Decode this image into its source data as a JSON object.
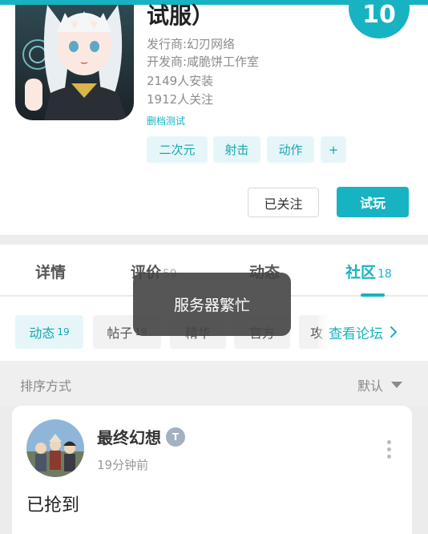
{
  "game": {
    "title": "试服）",
    "score": "10",
    "publisher": "发行商:幻刃网络",
    "developer": "开发商:咸脆饼工作室",
    "installs": "2149人安装",
    "followers": "1912人关注",
    "test_label": "删档测试",
    "tags": [
      "二次元",
      "射击",
      "动作",
      "+"
    ],
    "follow_label": "已关注",
    "play_label": "试玩"
  },
  "tabs": [
    {
      "label": "详情",
      "count": ""
    },
    {
      "label": "评价",
      "count": "59"
    },
    {
      "label": "动态",
      "count": ""
    },
    {
      "label": "社区",
      "count": "18"
    }
  ],
  "filters": {
    "chips": [
      {
        "label": "动态",
        "count": "19"
      },
      {
        "label": "帖子",
        "count": "19"
      },
      {
        "label": "精华",
        "count": ""
      },
      {
        "label": "官方",
        "count": ""
      },
      {
        "label": "攻",
        "count": ""
      }
    ],
    "forum_link": "查看论坛"
  },
  "sort": {
    "label": "排序方式",
    "value": "默认"
  },
  "post": {
    "author": "最终幻想",
    "badge": "T",
    "time": "19分钟前",
    "content": "已抢到"
  },
  "toast": "服务器繁忙",
  "colors": {
    "accent": "#17b3c2",
    "tag_bg": "#e6f6f8"
  }
}
